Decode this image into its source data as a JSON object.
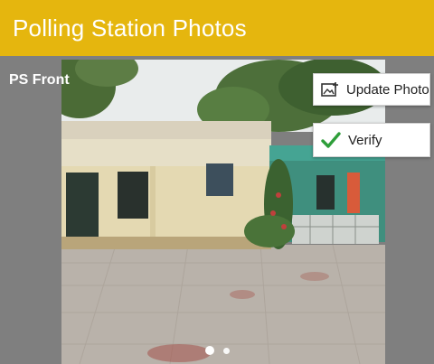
{
  "header": {
    "title": "Polling Station Photos"
  },
  "gallery": {
    "caption": "PS Front",
    "actions": {
      "update_label": "Update Photo",
      "verify_label": "Verify"
    },
    "pager": {
      "total": 2,
      "current": 1
    }
  },
  "colors": {
    "header_bg": "#e5b60e",
    "gallery_bg": "#7f7f7f",
    "verify_check": "#2e9e3a"
  },
  "icons": {
    "update": "image-upload-icon",
    "verify": "checkmark-icon"
  }
}
